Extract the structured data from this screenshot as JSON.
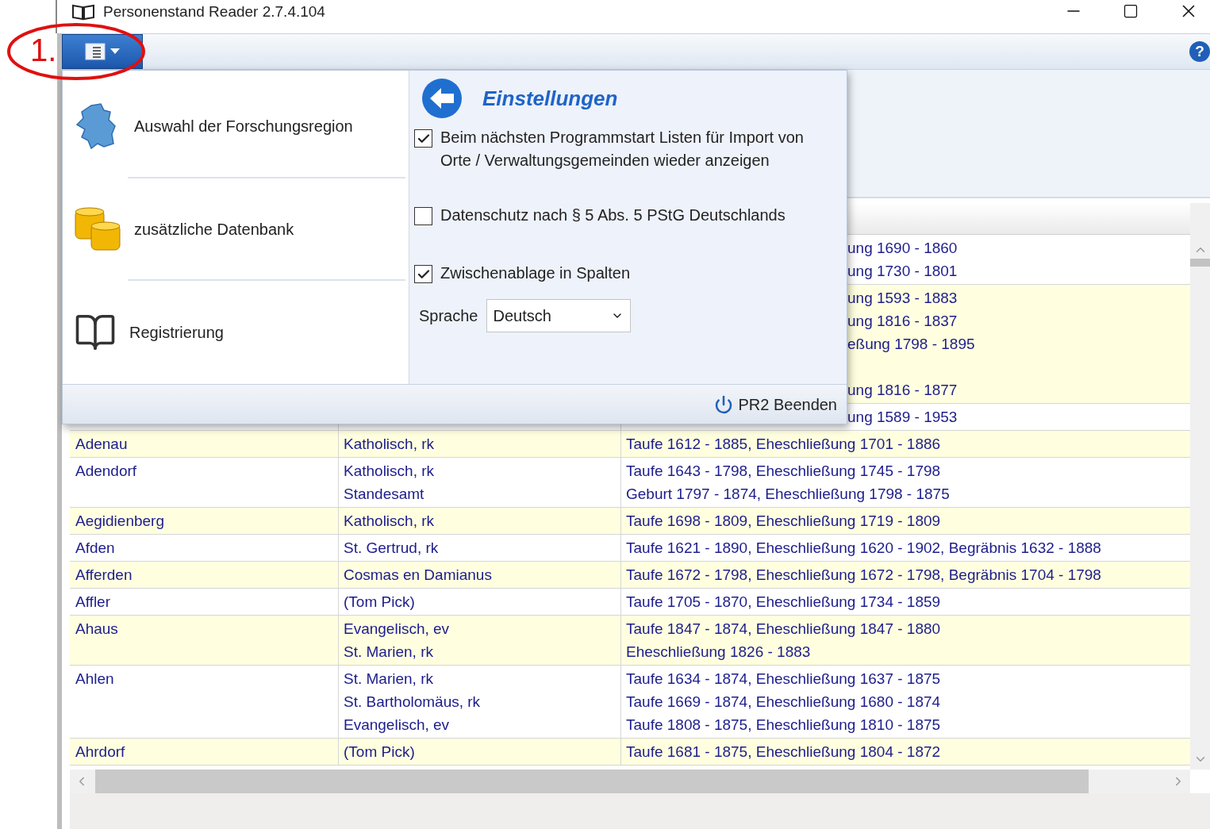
{
  "window": {
    "title": "Personenstand Reader 2.7.4.104"
  },
  "annotation": {
    "label": "1."
  },
  "app_menu": {
    "expanded": true,
    "items": [
      {
        "label": "Auswahl der Forschungsregion",
        "kind": "map"
      },
      {
        "label": "zusätzliche Datenbank",
        "kind": "coins"
      },
      {
        "label": "Registrierung",
        "kind": "book"
      }
    ],
    "settings": {
      "title": "Einstellungen",
      "options": [
        {
          "label": "Beim nächsten Programmstart Listen für Import von Orte / Verwaltungsgemeinden wieder anzeigen",
          "checked": true
        },
        {
          "label": "Datenschutz nach § 5 Abs. 5 PStG Deutschlands",
          "checked": false
        },
        {
          "label": "Zwischenablage in Spalten",
          "checked": true
        }
      ],
      "language": {
        "label": "Sprache",
        "value": "Deutsch"
      }
    },
    "exit_button": "PR2 Beenden"
  },
  "help_button": "?",
  "table": {
    "rows": [
      {
        "kind": "covered",
        "records": [
          "ung 1690 - 1860",
          "ung 1730 - 1801"
        ]
      },
      {
        "kind": "covered",
        "records": [
          "ung 1593 - 1883",
          "ung 1816 - 1837",
          "eßung 1798 - 1895"
        ],
        "records_after_gap": [
          "ung 1816 - 1877"
        ]
      },
      {
        "kind": "covered",
        "records": [
          "ung 1589 - 1953"
        ]
      },
      {
        "kind": "full",
        "place": "Adenau",
        "church": [
          "Katholisch, rk"
        ],
        "records": [
          "Taufe 1612 - 1885, Eheschließung 1701 - 1886"
        ]
      },
      {
        "kind": "full",
        "place": "Adendorf",
        "church": [
          "Katholisch, rk",
          "Standesamt"
        ],
        "records": [
          "Taufe 1643 - 1798, Eheschließung 1745 - 1798",
          "Geburt 1797 - 1874, Eheschließung 1798 - 1875"
        ]
      },
      {
        "kind": "full",
        "place": "Aegidienberg",
        "church": [
          "Katholisch, rk"
        ],
        "records": [
          "Taufe 1698 - 1809, Eheschließung 1719 - 1809"
        ]
      },
      {
        "kind": "full",
        "place": "Afden",
        "church": [
          "St. Gertrud, rk"
        ],
        "records": [
          "Taufe 1621 - 1890, Eheschließung 1620 - 1902, Begräbnis 1632 - 1888"
        ]
      },
      {
        "kind": "full",
        "place": "Afferden",
        "church": [
          "Cosmas en Damianus"
        ],
        "records": [
          "Taufe 1672 - 1798, Eheschließung 1672 - 1798, Begräbnis 1704 - 1798"
        ]
      },
      {
        "kind": "full",
        "place": "Affler",
        "church": [
          "(Tom Pick)"
        ],
        "records": [
          "Taufe 1705 - 1870, Eheschließung 1734 - 1859"
        ]
      },
      {
        "kind": "full",
        "place": "Ahaus",
        "church": [
          "Evangelisch, ev",
          "St. Marien, rk"
        ],
        "records": [
          "Taufe 1847 - 1874, Eheschließung 1847 - 1880",
          "Eheschließung 1826 - 1883"
        ]
      },
      {
        "kind": "full",
        "place": "Ahlen",
        "church": [
          "St. Marien, rk",
          "St. Bartholomäus, rk",
          "Evangelisch, ev"
        ],
        "records": [
          "Taufe 1634 - 1874, Eheschließung 1637 - 1875",
          "Taufe 1669 - 1874, Eheschließung 1680 - 1874",
          "Taufe 1808 - 1875, Eheschließung 1810 - 1875"
        ]
      },
      {
        "kind": "full",
        "place": "Ahrdorf",
        "church": [
          "(Tom Pick)"
        ],
        "records": [
          "Taufe 1681 - 1875, Eheschließung 1804 - 1872"
        ]
      }
    ]
  }
}
